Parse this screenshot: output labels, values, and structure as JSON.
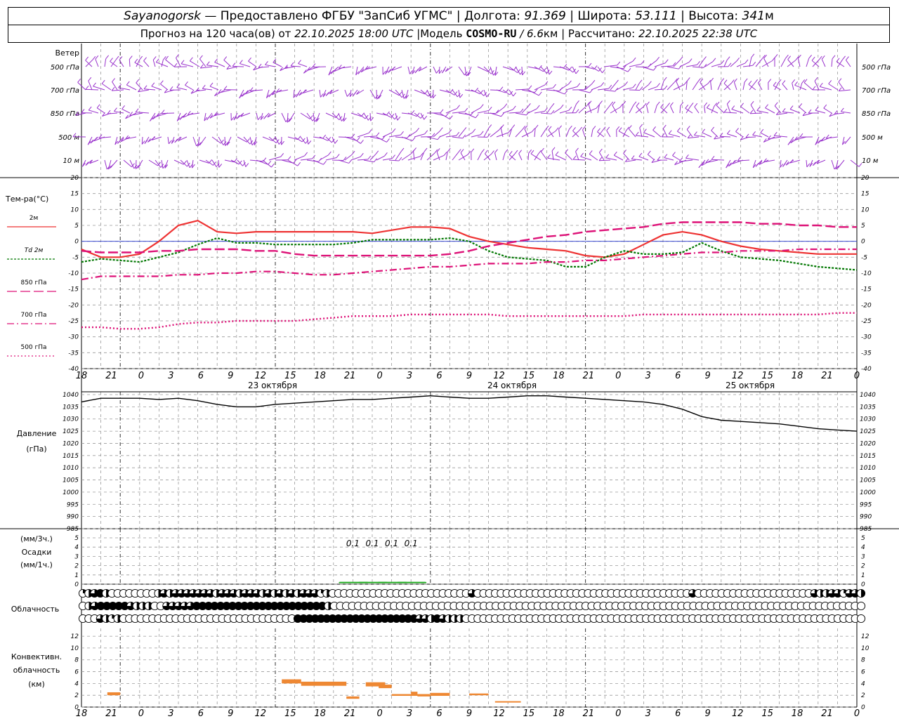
{
  "header": {
    "city": "Sayanogorsk",
    "dash": " — ",
    "provider": "Предоставлено ФГБУ \"ЗапСиб УГМС\"",
    "sep": " | ",
    "lon_label": "Долгота: ",
    "lon_value": "91.369",
    "lat_label": "Широта: ",
    "lat_value": "53.111",
    "alt_label": "Высота: ",
    "alt_value": "341",
    "alt_unit": "м",
    "forecast_label": "Прогноз на 120 часа(ов) от ",
    "forecast_start": "22.10.2025 18:00 UTC",
    "model_label": " |Модель ",
    "model_name": "COSMO-RU",
    "model_res": " / 6.6",
    "model_res_unit": "км",
    "calc_label": " | Рассчитано: ",
    "calc_time": "22.10.2025 22:38 UTC"
  },
  "time_axis": {
    "hour_labels": [
      "18",
      "21",
      "0",
      "3",
      "6",
      "9",
      "12",
      "15",
      "18",
      "21",
      "0",
      "3",
      "6",
      "9",
      "12",
      "15",
      "18",
      "21",
      "0",
      "3",
      "6",
      "9",
      "12",
      "15",
      "18",
      "21",
      "0"
    ],
    "day_labels": [
      "23 октября",
      "24 октября",
      "25 октября"
    ]
  },
  "wind_panel": {
    "title": "Ветер",
    "levels": [
      "500 гПа",
      "700 гПа",
      "850 гПа",
      "500 м",
      "10  м"
    ],
    "barb_color": "#9932cc"
  },
  "colors": {
    "t2m": "#ee3333",
    "td2m": "#007700",
    "t850": "#dd1177",
    "t700": "#dd1177",
    "t500": "#dd1177",
    "pressure": "#000000",
    "precip": "#22aa22",
    "convective": "#ee8833",
    "zero_line": "#2233cc",
    "grid": "#999999"
  },
  "chart_data": [
    {
      "type": "line",
      "title": "Тем-ра(°C)",
      "ylim": [
        -40,
        20
      ],
      "yticks": [
        "20",
        "15",
        "10",
        "5",
        "0",
        "-5",
        "-10",
        "-15",
        "-20",
        "-25",
        "-30",
        "-35",
        "-40"
      ],
      "x_hours": [
        0,
        3,
        6,
        9,
        12,
        15,
        18,
        21,
        24,
        27,
        30,
        33,
        36,
        39,
        42,
        45,
        48,
        51,
        54,
        57,
        60,
        63,
        66,
        69,
        72,
        75,
        78,
        81,
        84,
        87,
        90,
        93,
        96,
        99,
        102,
        105,
        108,
        111,
        114,
        117,
        120
      ],
      "series": [
        {
          "name": "2м",
          "values": [
            -2.5,
            -5,
            -5,
            -4,
            0,
            5,
            6.5,
            3,
            2.5,
            3,
            3,
            3,
            3,
            3,
            3,
            2.5,
            3.5,
            4.5,
            4.5,
            4,
            1.5,
            0,
            -1,
            -2,
            -2.5,
            -3,
            -4.5,
            -5,
            -4,
            -1,
            2,
            3,
            2,
            0,
            -1.5,
            -2.5,
            -3,
            -3.5,
            -4,
            -4,
            -4
          ]
        },
        {
          "name": "Td 2м",
          "values": [
            -6.5,
            -5.5,
            -6,
            -6.5,
            -5,
            -3.5,
            -1,
            1,
            -0.5,
            -0.5,
            -1,
            -1,
            -1,
            -1,
            -0.5,
            0.5,
            0.5,
            0.5,
            0.5,
            1,
            0,
            -3,
            -5,
            -5.5,
            -6,
            -8,
            -8,
            -5,
            -3,
            -4,
            -4,
            -3.5,
            -0.5,
            -3,
            -5,
            -5.5,
            -6,
            -7,
            -8,
            -8.5,
            -9
          ]
        },
        {
          "name": "850 гПа",
          "values": [
            -3,
            -3.5,
            -3.5,
            -3.5,
            -3,
            -3,
            -2.5,
            -2.5,
            -2.5,
            -3,
            -3,
            -4,
            -4.5,
            -4.5,
            -4.5,
            -4.5,
            -4.5,
            -4.5,
            -4.5,
            -4,
            -3,
            -1.5,
            -0.5,
            0.5,
            1.5,
            2,
            3,
            3.5,
            4,
            4.5,
            5.5,
            6,
            6,
            6,
            6,
            5.5,
            5.5,
            5,
            5,
            4.5,
            4.5
          ]
        },
        {
          "name": "700 гПа",
          "values": [
            -12,
            -11,
            -11,
            -11,
            -11,
            -10.5,
            -10.5,
            -10,
            -10,
            -9.5,
            -9.5,
            -10,
            -10.5,
            -10.5,
            -10,
            -9.5,
            -9,
            -8.5,
            -8,
            -8,
            -7.5,
            -7,
            -7,
            -7,
            -6.5,
            -6.5,
            -6,
            -6,
            -5.5,
            -5,
            -4.5,
            -4,
            -3.5,
            -3.5,
            -3,
            -3,
            -3,
            -2.5,
            -2.5,
            -2.5,
            -2.5
          ]
        },
        {
          "name": "500 гПа",
          "values": [
            -27,
            -27,
            -27.5,
            -27.5,
            -27,
            -26,
            -25.5,
            -25.5,
            -25,
            -25,
            -25,
            -25,
            -24.5,
            -24,
            -23.5,
            -23.5,
            -23.5,
            -23,
            -23,
            -23,
            -23,
            -23,
            -23.5,
            -23.5,
            -23.5,
            -23.5,
            -23.5,
            -23.5,
            -23.5,
            -23,
            -23,
            -23,
            -23,
            -23,
            -23,
            -23,
            -23,
            -23,
            -23,
            -22.5,
            -22.5
          ]
        }
      ]
    },
    {
      "type": "line",
      "title": "Давление",
      "ylabel": "(гПа)",
      "ylim": [
        985,
        1040
      ],
      "yticks": [
        "1040",
        "1035",
        "1030",
        "1025",
        "1020",
        "1015",
        "1010",
        "1005",
        "1000",
        "995",
        "990",
        "985"
      ],
      "x_hours": [
        0,
        3,
        6,
        9,
        12,
        15,
        18,
        21,
        24,
        27,
        30,
        33,
        36,
        39,
        42,
        45,
        48,
        51,
        54,
        57,
        60,
        63,
        66,
        69,
        72,
        75,
        78,
        81,
        84,
        87,
        90,
        93,
        96,
        99,
        102,
        105,
        108,
        111,
        114,
        117,
        120
      ],
      "series": [
        {
          "name": "",
          "values": [
            1037,
            1038.5,
            1038.5,
            1038.5,
            1038,
            1038.5,
            1037.5,
            1036,
            1035,
            1035,
            1036,
            1036.5,
            1037,
            1037.5,
            1038,
            1038,
            1038.5,
            1039,
            1039.5,
            1039,
            1038.5,
            1038.5,
            1039,
            1039.5,
            1039.5,
            1039,
            1038.5,
            1038,
            1037.5,
            1037,
            1036,
            1034,
            1031,
            1029.5,
            1029,
            1028.5,
            1028,
            1027,
            1026,
            1025.5,
            1025
          ]
        }
      ]
    },
    {
      "type": "bar",
      "title": "Осадки",
      "ylabel": "(мм/3ч.)",
      "ylabel2": "(мм/1ч.)",
      "ylim": [
        0,
        5
      ],
      "yticks": [
        "5",
        "4",
        "3",
        "2",
        "1",
        "0"
      ],
      "x_hours": [
        42,
        45,
        48,
        51
      ],
      "values": [
        0.1,
        0.1,
        0.1,
        0.1
      ],
      "value_labels": [
        "0.1",
        "0.1",
        "0.1",
        "0.1"
      ]
    },
    {
      "type": "table",
      "title": "Облачность",
      "rows": [
        [
          0.25,
          0.5,
          0.75,
          1,
          0.5,
          0,
          0,
          0,
          0,
          0,
          0,
          0,
          0,
          0.5,
          0.75,
          0.5,
          0.75,
          0.75,
          0.75,
          0.75,
          0.75,
          0.75,
          0.75,
          0.5,
          0.75,
          0.75,
          0.75,
          0.5,
          0.75,
          0.75,
          0.75,
          0.5,
          0.75,
          0.5,
          0.75,
          0.5,
          0.75,
          0.5,
          0.75,
          0.75,
          0.75,
          0.25,
          0.5,
          0,
          0,
          0,
          0,
          0,
          0,
          0,
          0,
          0,
          0,
          0,
          0,
          0,
          0,
          0,
          0,
          0,
          0,
          0,
          0,
          0,
          0,
          0,
          0,
          0.75,
          0,
          0,
          0,
          0,
          0,
          0,
          0,
          0,
          0,
          0,
          0,
          0,
          0,
          0,
          0,
          0,
          0,
          0,
          0,
          0,
          0,
          0,
          0,
          0,
          0,
          0,
          0,
          0,
          0,
          0,
          0,
          0,
          0,
          0,
          0,
          0,
          0,
          0.75,
          0,
          0,
          0,
          0,
          0,
          0,
          0,
          0,
          0,
          0,
          0,
          0,
          0,
          0,
          0,
          0,
          0,
          0,
          0,
          0,
          0.75,
          0.5,
          0.5,
          0.75,
          0.75,
          0.25,
          0.75,
          0.75,
          0.5
        ],
        [
          0,
          0.5,
          0.75,
          1,
          1,
          1,
          1,
          1,
          0.75,
          0.5,
          0.5,
          0.5,
          0,
          0,
          0.75,
          0.75,
          0.75,
          0.75,
          0.75,
          1,
          1,
          1,
          1,
          1,
          1,
          1,
          1,
          1,
          1,
          1,
          1,
          1,
          1,
          1,
          1,
          1,
          1,
          1,
          1,
          1,
          1,
          0.5,
          0,
          0,
          0,
          0,
          0,
          0,
          0,
          0,
          0,
          0,
          0,
          0,
          0,
          0,
          0,
          0,
          0,
          0,
          0,
          0,
          0,
          0,
          0,
          0,
          0,
          0,
          0,
          0,
          0,
          0,
          0,
          0,
          0,
          0,
          0,
          0,
          0,
          0,
          0,
          0,
          0,
          0,
          0,
          0,
          0,
          0,
          0,
          0,
          0,
          0,
          0,
          0,
          0,
          0,
          0,
          0,
          0,
          0,
          0,
          0,
          0,
          0,
          0,
          0,
          0,
          0,
          0,
          0,
          0,
          0,
          0,
          0,
          0,
          0,
          0,
          0,
          0,
          0,
          0,
          0,
          0,
          0,
          0,
          0,
          0,
          0,
          0,
          0,
          0
        ],
        [
          0,
          0,
          0,
          0.75,
          0.5,
          0.25,
          0.5,
          0,
          0,
          0,
          0,
          0,
          0,
          0,
          0,
          0,
          0,
          0,
          0,
          0,
          0,
          0,
          0,
          0,
          0,
          0,
          0,
          0,
          0,
          0,
          0,
          0,
          0,
          0,
          0,
          0,
          0,
          1,
          1,
          1,
          1,
          1,
          1,
          1,
          1,
          1,
          1,
          1,
          1,
          1,
          1,
          1,
          1,
          1,
          1,
          1,
          1,
          1,
          0.75,
          0.75,
          0.5,
          1,
          0.75,
          0.5,
          0.5,
          0.5,
          0,
          0,
          0,
          0,
          0,
          0,
          0,
          0,
          0,
          0,
          0,
          0,
          0,
          0,
          0,
          0,
          0,
          0,
          0,
          0,
          0,
          0,
          0,
          0,
          0,
          0,
          0,
          0,
          0,
          0,
          0,
          0,
          0,
          0,
          0,
          0,
          0,
          0,
          0,
          0,
          0,
          0,
          0,
          0,
          0,
          0,
          0,
          0,
          0,
          0,
          0,
          0,
          0,
          0,
          0,
          0,
          0,
          0,
          0,
          0,
          0,
          0,
          0,
          0,
          0,
          0,
          0,
          0,
          0
        ]
      ]
    },
    {
      "type": "bar",
      "title": "Конвективн.",
      "title2": "облачность",
      "ylabel": "(км)",
      "ylim": [
        0,
        14
      ],
      "yticks": [
        "12",
        "10",
        "8",
        "6",
        "4",
        "2",
        "0"
      ],
      "segments": [
        {
          "start": 4,
          "end": 6,
          "bottom": 2,
          "top": 2.5
        },
        {
          "start": 31,
          "end": 34,
          "bottom": 4,
          "top": 4.7
        },
        {
          "start": 34,
          "end": 41,
          "bottom": 3.6,
          "top": 4.3
        },
        {
          "start": 41,
          "end": 43,
          "bottom": 1.4,
          "top": 1.8
        },
        {
          "start": 44,
          "end": 47,
          "bottom": 3.5,
          "top": 4.2
        },
        {
          "start": 46,
          "end": 48,
          "bottom": 3.2,
          "top": 3.8
        },
        {
          "start": 48,
          "end": 53,
          "bottom": 1.9,
          "top": 2.2
        },
        {
          "start": 51,
          "end": 52,
          "bottom": 2.2,
          "top": 2.6
        },
        {
          "start": 52,
          "end": 54,
          "bottom": 1.8,
          "top": 2.2
        },
        {
          "start": 54,
          "end": 57,
          "bottom": 1.9,
          "top": 2.4
        },
        {
          "start": 60,
          "end": 63,
          "bottom": 2,
          "top": 2.3
        },
        {
          "start": 64,
          "end": 68,
          "bottom": 0.8,
          "top": 1
        }
      ]
    }
  ]
}
